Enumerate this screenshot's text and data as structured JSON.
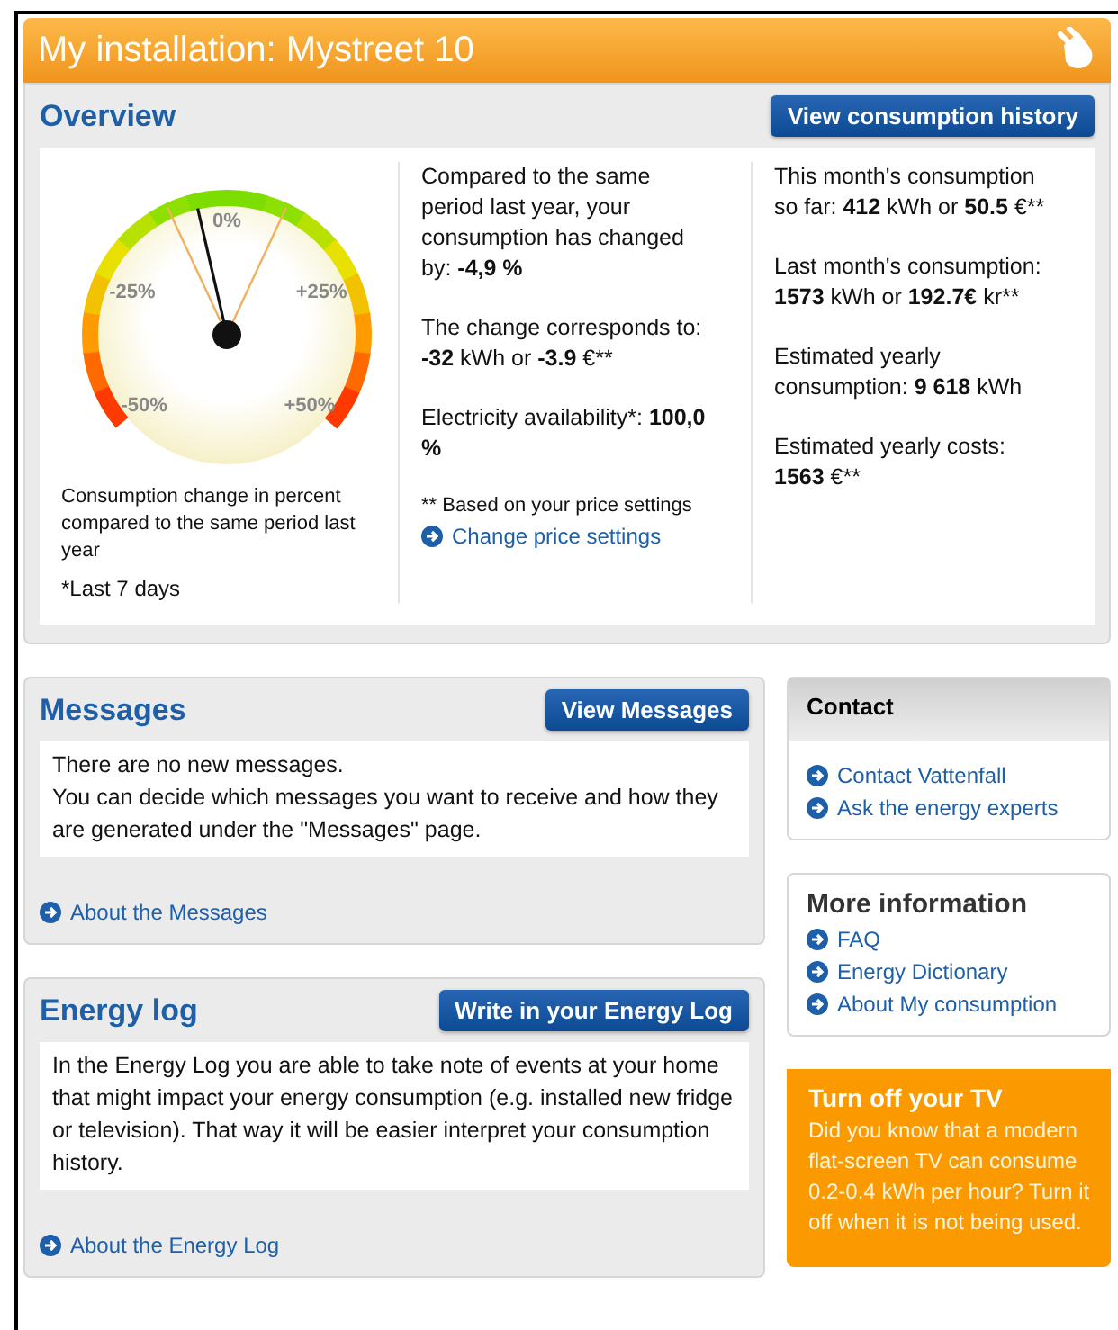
{
  "header": {
    "title": "My installation: Mystreet 10"
  },
  "overview": {
    "title": "Overview",
    "button": "View consumption history",
    "gauge": {
      "tick_labels": [
        "-50%",
        "-25%",
        "0%",
        "+25%",
        "+50%"
      ],
      "caption": "Consumption change in percent compared to the same period last year",
      "footnote": "*Last 7 days"
    },
    "column_2": [
      "Compared to the same period last year, your consumption has changed by: **-4,9 %**",
      "The change corresponds to: **-32** kWh or **-3.9** €**",
      "Electricity availability*: **100,0 %**"
    ],
    "price_note": "** Based on your price settings",
    "price_link": "Change price settings",
    "column_3": [
      "This month's consumption so far: **412** kWh or **50.5** €**",
      "Last month's consumption: **1573** kWh or **192.7€** kr**",
      "Estimated yearly consumption: **9 618** kWh",
      "Estimated yearly costs: **1563** €**"
    ]
  },
  "messages": {
    "title": "Messages",
    "button": "View Messages",
    "body": [
      "There are no new messages.",
      "You can decide which messages you want to receive and how they are generated under the \"Messages\" page."
    ],
    "link": "About the Messages"
  },
  "energy_log": {
    "title": "Energy log",
    "button": "Write in your Energy Log",
    "body": [
      "In the Energy Log you are able to take note of events at your home that might impact your energy consumption (e.g. installed new fridge or television). That way it will be easier interpret your consumption history."
    ],
    "link": "About the Energy Log"
  },
  "contact": {
    "title": "Contact",
    "links": [
      "Contact Vattenfall",
      "Ask the energy experts"
    ]
  },
  "more_information": {
    "title": "More information",
    "links": [
      "FAQ",
      "Energy Dictionary",
      "About My consumption"
    ]
  },
  "tip": {
    "title": "Turn off your TV",
    "text": "Did you know that a modern flat-screen TV can consume 0.2-0.4 kWh per hour? Turn it off when it is not being used."
  }
}
